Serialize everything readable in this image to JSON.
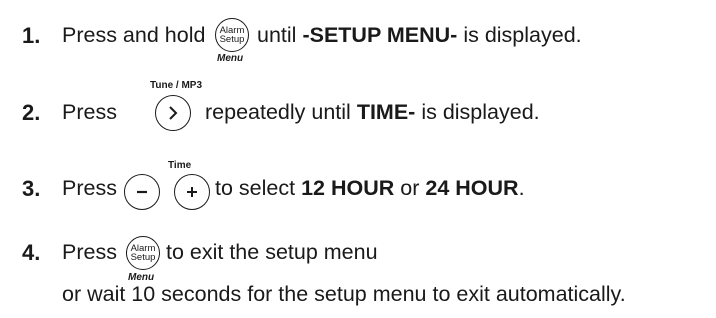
{
  "steps": [
    {
      "number": "1.",
      "text_before": "Press and hold",
      "text_after": "until",
      "bold": "-SETUP MENU-",
      "text_end": "is displayed.",
      "button": {
        "line1": "Alarm",
        "line2": "Setup",
        "caption": "Menu",
        "icon": "alarm-setup-button"
      }
    },
    {
      "number": "2.",
      "text_before": "Press",
      "text_after": "repeatedly until",
      "bold": "TIME-",
      "text_end": "is displayed.",
      "button": {
        "caption_top": "Tune / MP3",
        "icon": "chevron-right-icon"
      }
    },
    {
      "number": "3.",
      "text_before": "Press",
      "text_after": "to select",
      "bold": "12 HOUR",
      "text_mid": "or",
      "bold2": "24 HOUR",
      "text_end": ".",
      "button": {
        "caption_top": "Time",
        "icons": [
          "minus-icon",
          "plus-icon"
        ]
      }
    },
    {
      "number": "4.",
      "text_before": "Press",
      "text_after": "to exit the setup menu",
      "text_line2": "or wait 10 seconds for the setup menu to exit automatically.",
      "button": {
        "line1": "Alarm",
        "line2": "Setup",
        "caption": "Menu",
        "icon": "alarm-setup-button"
      }
    }
  ],
  "colors": {
    "text": "#1a1a1a",
    "background": "#ffffff"
  }
}
